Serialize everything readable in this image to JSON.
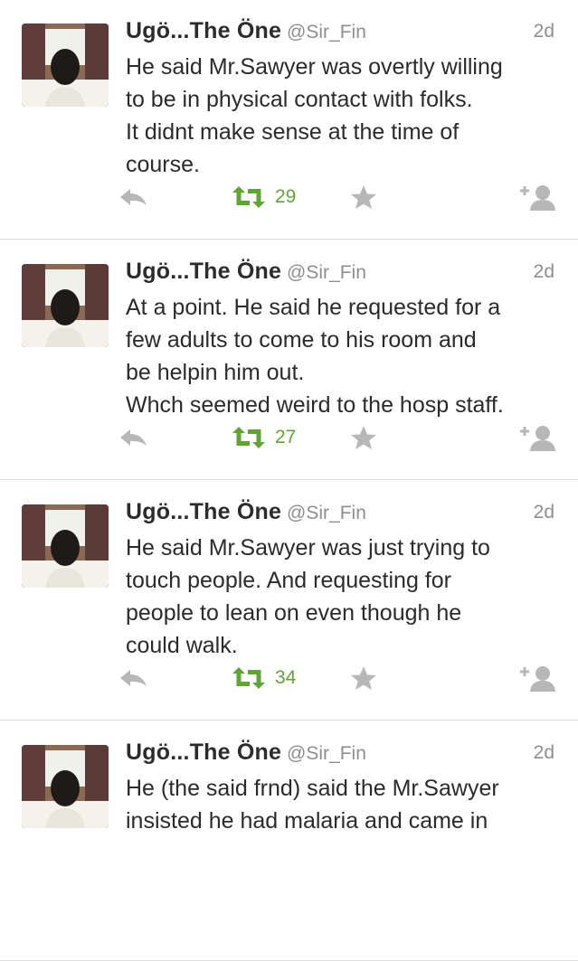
{
  "accent_color": "#5fa533",
  "tweets": [
    {
      "display_name": "Ugö...The Öne",
      "handle": "@Sir_Fin",
      "timestamp": "2d",
      "lines": [
        "He said Mr.Sawyer was overtly willing",
        "to be in physical contact with folks.",
        "It didnt make sense at the time of",
        "course."
      ],
      "retweet_count": "29",
      "avatar_icon": "user-avatar",
      "reply_icon": "reply-icon",
      "retweet_icon": "retweet-icon",
      "favorite_icon": "star-icon",
      "follow_icon": "add-user-icon"
    },
    {
      "display_name": "Ugö...The Öne",
      "handle": "@Sir_Fin",
      "timestamp": "2d",
      "lines": [
        "At a point. He said he requested for a",
        "few adults to come to his room and",
        "be helpin him out.",
        "Whch seemed weird to the hosp staff."
      ],
      "retweet_count": "27",
      "avatar_icon": "user-avatar",
      "reply_icon": "reply-icon",
      "retweet_icon": "retweet-icon",
      "favorite_icon": "star-icon",
      "follow_icon": "add-user-icon"
    },
    {
      "display_name": "Ugö...The Öne",
      "handle": "@Sir_Fin",
      "timestamp": "2d",
      "lines": [
        "He said Mr.Sawyer was just trying to",
        "touch people. And requesting for",
        "people to lean on even though he",
        "could walk."
      ],
      "retweet_count": "34",
      "avatar_icon": "user-avatar",
      "reply_icon": "reply-icon",
      "retweet_icon": "retweet-icon",
      "favorite_icon": "star-icon",
      "follow_icon": "add-user-icon"
    },
    {
      "display_name": "Ugö...The Öne",
      "handle": "@Sir_Fin",
      "timestamp": "2d",
      "lines": [
        "He (the said frnd) said the Mr.Sawyer",
        "insisted he had malaria and came in"
      ],
      "retweet_count": "",
      "avatar_icon": "user-avatar",
      "reply_icon": "reply-icon",
      "retweet_icon": "retweet-icon",
      "favorite_icon": "star-icon",
      "follow_icon": "add-user-icon"
    }
  ]
}
